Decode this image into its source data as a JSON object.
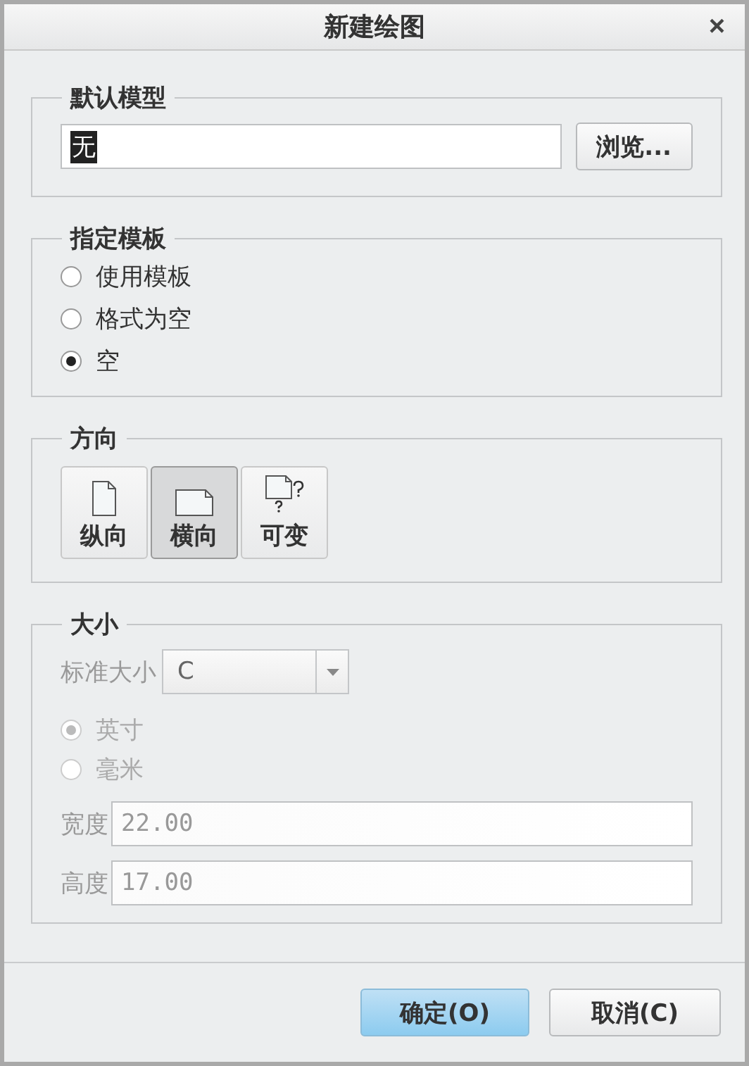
{
  "window": {
    "title": "新建绘图",
    "close": "×"
  },
  "default_model": {
    "legend": "默认模型",
    "value": "无",
    "value_selected": true,
    "browse": "浏览..."
  },
  "template": {
    "legend": "指定模板",
    "options": [
      {
        "label": "使用模板",
        "selected": false
      },
      {
        "label": "格式为空",
        "selected": false
      },
      {
        "label": "空",
        "selected": true
      }
    ]
  },
  "orientation": {
    "legend": "方向",
    "options": [
      {
        "label": "纵向",
        "kind": "portrait",
        "selected": false
      },
      {
        "label": "横向",
        "kind": "landscape",
        "selected": true
      },
      {
        "label": "可变",
        "kind": "variable",
        "selected": false
      }
    ]
  },
  "size": {
    "legend": "大小",
    "disabled": true,
    "standard_label": "标准大小",
    "standard_value": "C",
    "units": [
      {
        "label": "英寸",
        "selected": true
      },
      {
        "label": "毫米",
        "selected": false
      }
    ],
    "width_label": "宽度",
    "width_value": "22.00",
    "height_label": "高度",
    "height_value": "17.00"
  },
  "buttons": [
    {
      "label": "确定(O)",
      "default": true
    },
    {
      "label": "取消(C)",
      "default": false
    }
  ]
}
